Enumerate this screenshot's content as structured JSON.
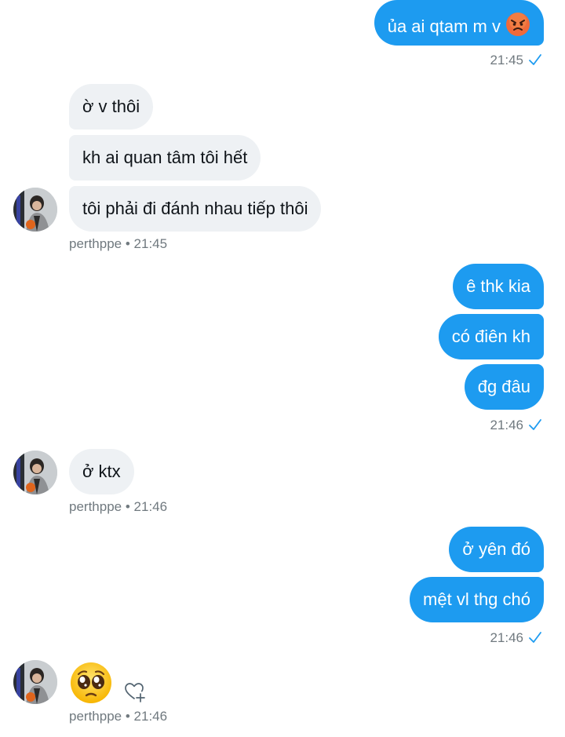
{
  "messages": {
    "m1": "ủa ai qtam m v",
    "t1": "21:45",
    "g1": [
      "ờ v thôi",
      "kh ai quan tâm tôi hết",
      "tôi phải đi đánh nhau tiếp thôi"
    ],
    "t2_user": "perthppe",
    "t2_time": "21:45",
    "g2": [
      "ê thk kia",
      "có điên kh",
      "đg đâu"
    ],
    "t3": "21:46",
    "g3": "ở ktx",
    "t4_user": "perthppe",
    "t4_time": "21:46",
    "g4": [
      "ở yên đó",
      "mệt vl thg chó"
    ],
    "t5": "21:46",
    "t6_user": "perthppe",
    "t6_time": "21:46"
  },
  "separator": "•",
  "icons": {
    "angry_emoji": "angry-face",
    "pleading_emoji": "pleading-face",
    "react": "heart-plus",
    "sent": "check"
  },
  "colors": {
    "outgoing": "#1d9bf0",
    "incoming": "#eef1f4",
    "meta": "#70797f"
  }
}
